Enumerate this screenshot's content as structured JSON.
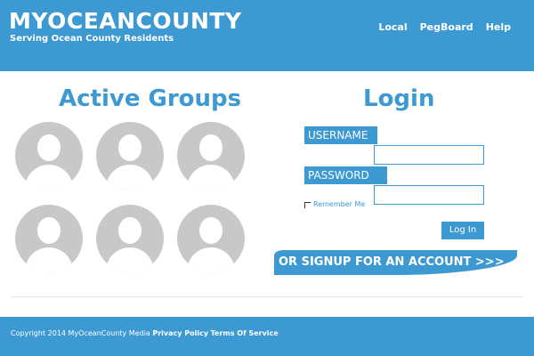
{
  "header": {
    "brand": "MYOCEANCOUNTY",
    "tagline": "Serving Ocean County Residents",
    "nav": [
      "Local",
      "PegBoard",
      "Help"
    ]
  },
  "groups": {
    "title": "Active Groups",
    "count": 6
  },
  "login": {
    "title": "Login",
    "username_label": "USERNAME",
    "password_label": "PASSWORD",
    "remember_label": "Remember Me",
    "login_button": "Log In",
    "signup_text": "OR SIGNUP FOR AN ACCOUNT >>>"
  },
  "footer": {
    "copyright": "Copyright 2014 MyOceanCounty Media",
    "privacy": "Privacy Policy",
    "terms": "Terms Of Service"
  },
  "colors": {
    "accent": "#3d99d1",
    "avatar_bg": "#c8c8c8"
  }
}
